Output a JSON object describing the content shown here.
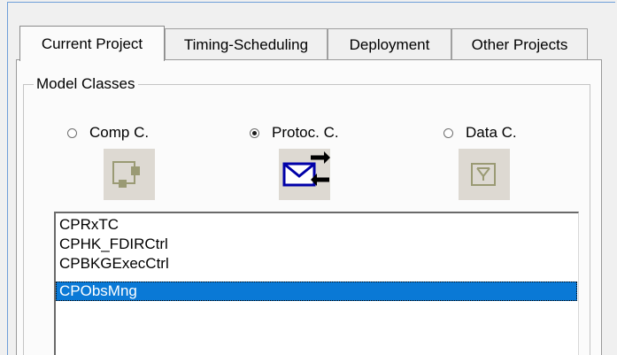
{
  "tabs": [
    {
      "label": "Current Project",
      "active": true
    },
    {
      "label": "Timing-Scheduling",
      "active": false
    },
    {
      "label": "Deployment",
      "active": false
    },
    {
      "label": "Other Projects",
      "active": false
    }
  ],
  "model_classes": {
    "group_label": "Model Classes",
    "options": [
      {
        "label": "Comp C.",
        "checked": false,
        "icon": "component-class-icon"
      },
      {
        "label": "Protoc. C.",
        "checked": true,
        "icon": "protocol-class-icon"
      },
      {
        "label": "Data C.",
        "checked": false,
        "icon": "data-class-icon"
      }
    ]
  },
  "class_list": {
    "items": [
      "CPRxTC",
      "CPHK_FDIRCtrl",
      "CPBKGExecCtrl",
      "CPObsMng"
    ],
    "selected_index": 3
  },
  "colors": {
    "selection": "#0a79d6",
    "protocol_icon_envelope": "#0000a8",
    "window_border": "#6f9fd8",
    "icon_disabled": "#9a9a74"
  }
}
